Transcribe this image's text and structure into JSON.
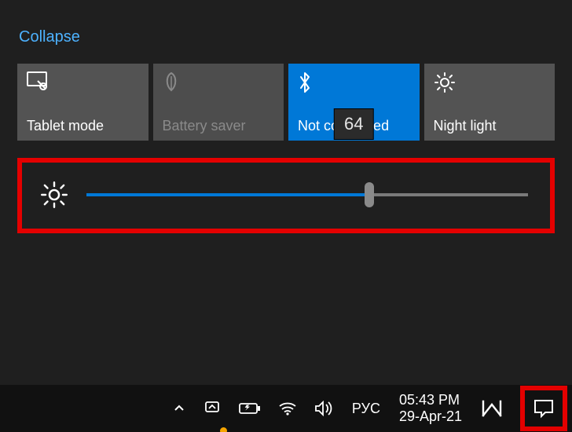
{
  "panel": {
    "collapse_label": "Collapse",
    "tiles": [
      {
        "label": "Tablet mode",
        "state": "normal"
      },
      {
        "label": "Battery saver",
        "state": "disabled"
      },
      {
        "label": "Not connected",
        "state": "active"
      },
      {
        "label": "Night light",
        "state": "normal"
      }
    ],
    "brightness": {
      "value": 64,
      "min": 0,
      "max": 100
    }
  },
  "taskbar": {
    "ime": "РУС",
    "time": "05:43 PM",
    "date": "29-Apr-21"
  },
  "colors": {
    "accent": "#0078d7",
    "highlight_box": "#e40000"
  }
}
